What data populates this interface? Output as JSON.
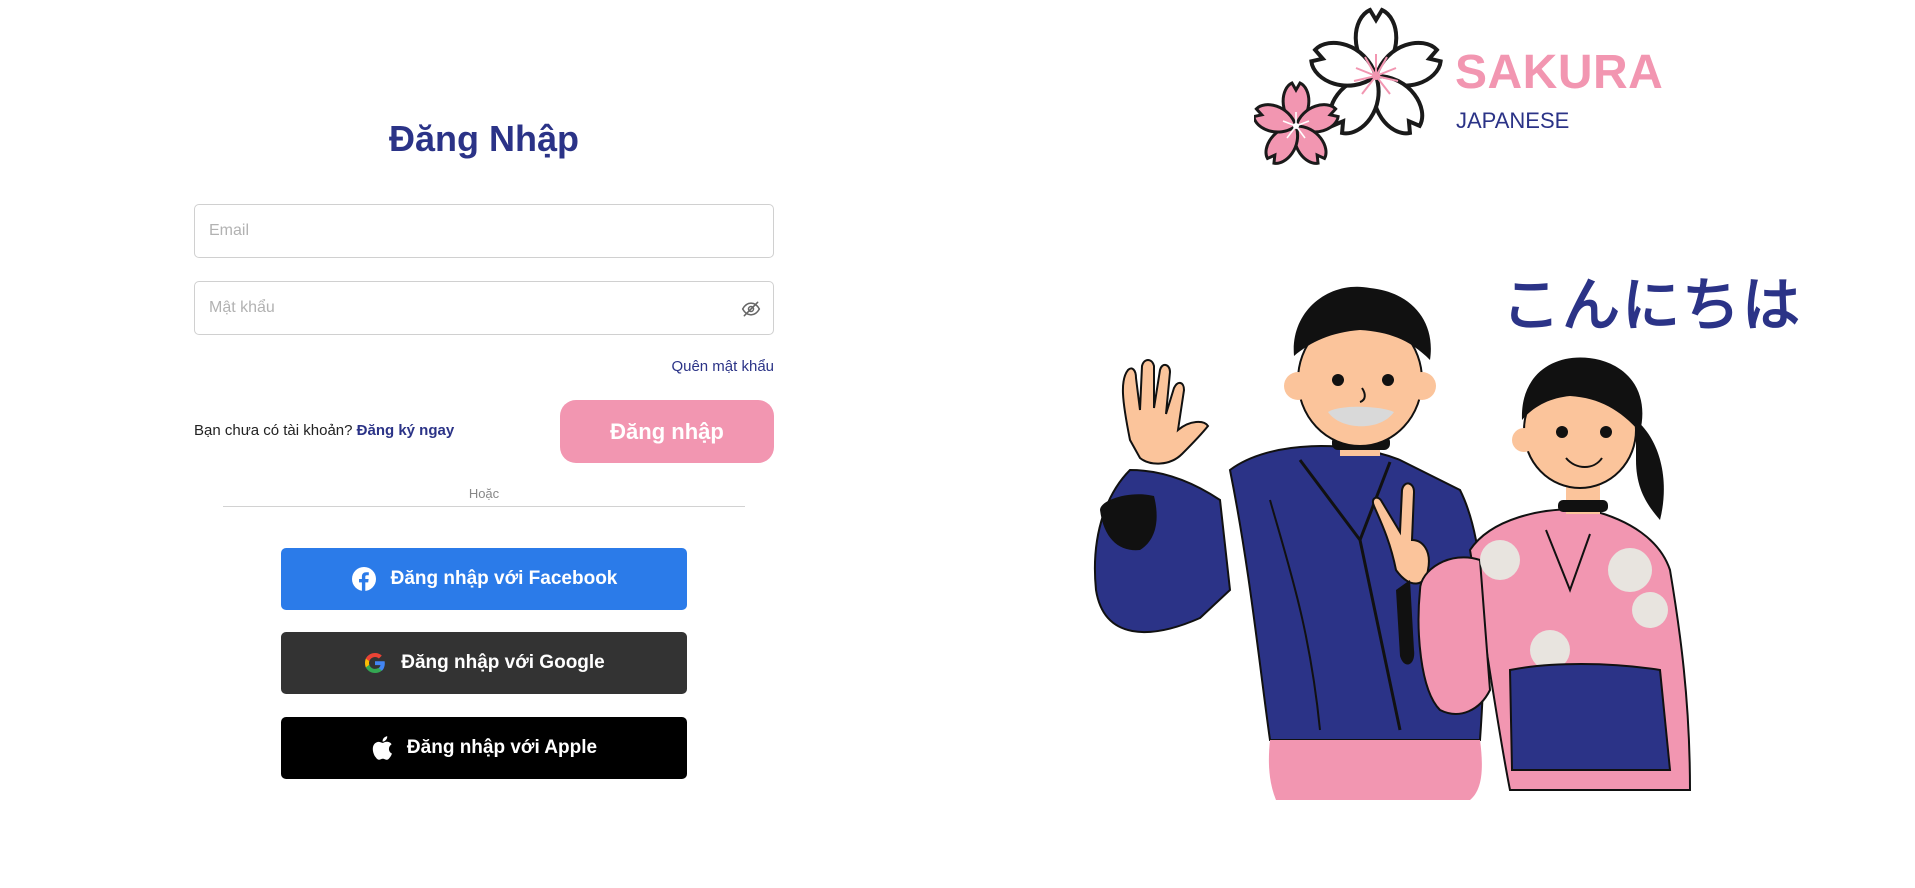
{
  "login": {
    "title": "Đăng Nhập",
    "email_placeholder": "Email",
    "password_placeholder": "Mật khẩu",
    "forgot_password": "Quên mật khẩu",
    "no_account_text": "Bạn chưa có tài khoản?",
    "signup_link": "Đăng ký ngay",
    "login_button": "Đăng nhập",
    "or_text": "Hoặc",
    "facebook_button": "Đăng nhập với Facebook",
    "google_button": "Đăng nhập với Google",
    "apple_button": "Đăng nhập với Apple"
  },
  "brand": {
    "name": "SAKURA",
    "subtitle": "JAPANESE",
    "greeting": "こんにちは"
  },
  "colors": {
    "primary_navy": "#2b3387",
    "sakura_pink": "#f296b1",
    "facebook_blue": "#2b7be9",
    "google_dark": "#333333",
    "apple_black": "#000000"
  },
  "icons": {
    "password_toggle": "eye-slash-icon",
    "facebook": "facebook-icon",
    "google": "google-icon",
    "apple": "apple-icon"
  }
}
